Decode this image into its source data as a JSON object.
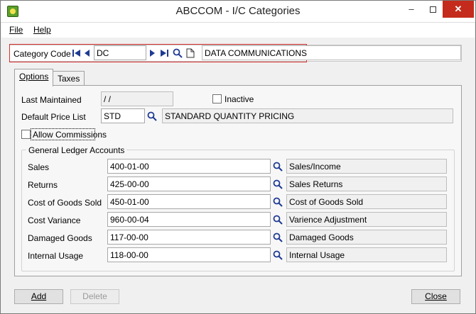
{
  "window": {
    "title": "ABCCOM - I/C Categories",
    "min_glyph": "–",
    "close_glyph": "✕"
  },
  "menu": {
    "file": "File",
    "help": "Help"
  },
  "header": {
    "category_code_label": "Category Code",
    "category_code_value": "DC",
    "category_description": "DATA COMMUNICATIONS"
  },
  "tabs": {
    "options": "Options",
    "taxes": "Taxes"
  },
  "options": {
    "last_maintained_label": "Last Maintained",
    "last_maintained_value": " /  /",
    "inactive_label": "Inactive",
    "default_price_list_label": "Default Price List",
    "default_price_list_code": "STD",
    "default_price_list_desc": "STANDARD QUANTITY PRICING",
    "allow_commissions_label": "Allow Commissions"
  },
  "gl": {
    "group_title": "General Ledger Accounts",
    "rows": [
      {
        "label": "Sales",
        "account": "400-01-00",
        "desc": "Sales/Income"
      },
      {
        "label": "Returns",
        "account": "425-00-00",
        "desc": "Sales Returns"
      },
      {
        "label": "Cost of Goods Sold",
        "account": "450-01-00",
        "desc": "Cost of Goods Sold"
      },
      {
        "label": "Cost Variance",
        "account": "960-00-04",
        "desc": "Varience Adjustment"
      },
      {
        "label": "Damaged Goods",
        "account": "117-00-00",
        "desc": "Damaged Goods"
      },
      {
        "label": "Internal Usage",
        "account": "118-00-00",
        "desc": "Internal Usage"
      }
    ]
  },
  "buttons": {
    "add": "Add",
    "delete": "Delete",
    "close": "Close"
  },
  "colors": {
    "highlight_frame": "#d9302f",
    "close_button": "#c42b1c"
  },
  "icons": [
    "app-icon",
    "first-record-icon",
    "previous-record-icon",
    "next-record-icon",
    "last-record-icon",
    "search-icon",
    "new-document-icon"
  ]
}
